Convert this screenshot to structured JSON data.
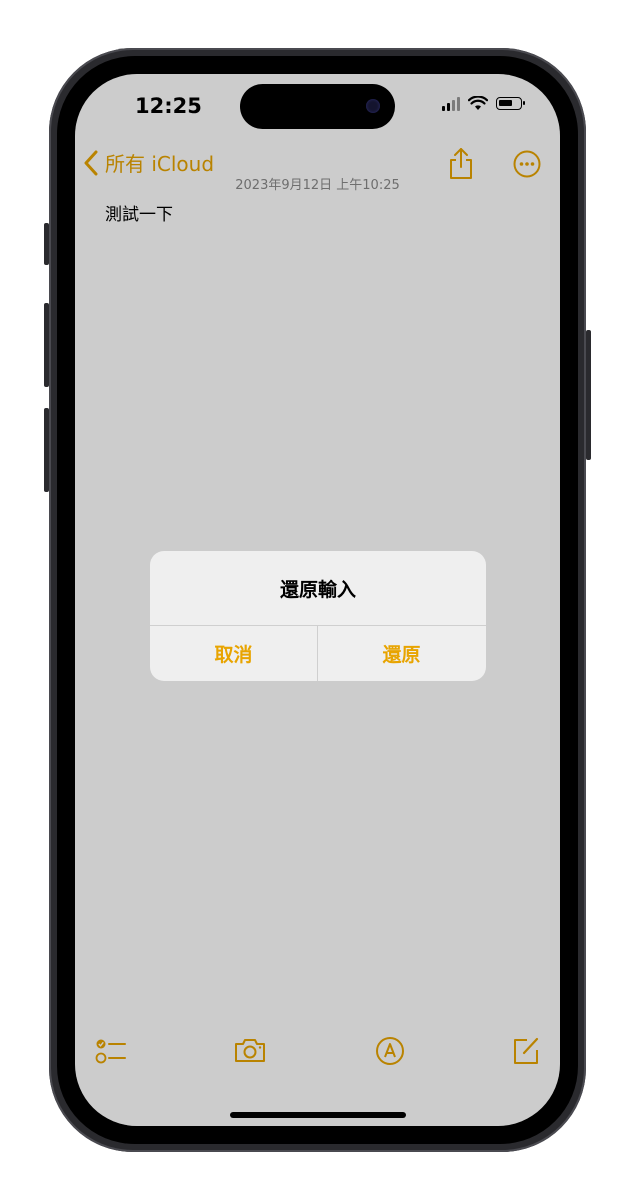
{
  "status_bar": {
    "time": "12:25"
  },
  "nav": {
    "back_label": "所有 iCloud"
  },
  "note": {
    "date": "2023年9月12日 上午10:25",
    "body": "測試一下"
  },
  "alert": {
    "title": "還原輸入",
    "cancel": "取消",
    "confirm": "還原"
  },
  "colors": {
    "accent": "#e8a400",
    "overlay": "rgba(0,0,0,0.2)",
    "alert_bg": "#efefef"
  }
}
